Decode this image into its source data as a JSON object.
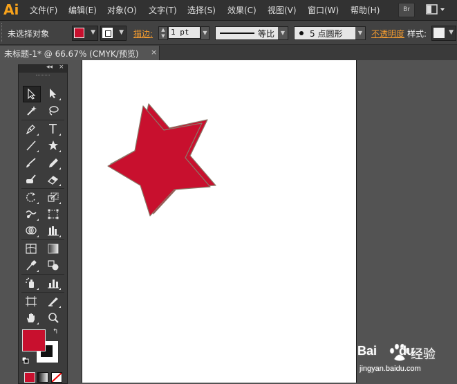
{
  "app": {
    "logo": "Ai",
    "bridge_button": "Br"
  },
  "menu": [
    "文件(F)",
    "编辑(E)",
    "对象(O)",
    "文字(T)",
    "选择(S)",
    "效果(C)",
    "视图(V)",
    "窗口(W)",
    "帮助(H)"
  ],
  "control_bar": {
    "selection_status": "未选择对象",
    "fill_color": "#c8102e",
    "stroke_label": "描边:",
    "stroke_weight": "1 pt",
    "profile_label": "等比",
    "brush_label": "5 点圆形",
    "opacity_label": "不透明度",
    "style_label": "样式:"
  },
  "document_tab": {
    "title": "未标题-1* @ 66.67% (CMYK/预览)",
    "close": "×"
  },
  "toolbox": {
    "collapse": "◂◂",
    "close": "×",
    "tools": [
      {
        "name": "selection-tool-icon",
        "active": true
      },
      {
        "name": "direct-selection-tool-icon"
      },
      {
        "name": "magic-wand-tool-icon"
      },
      {
        "name": "lasso-tool-icon"
      },
      {
        "name": "pen-tool-icon"
      },
      {
        "name": "type-tool-icon"
      },
      {
        "name": "line-segment-tool-icon"
      },
      {
        "name": "star-tool-icon"
      },
      {
        "name": "paintbrush-tool-icon"
      },
      {
        "name": "pencil-tool-icon"
      },
      {
        "name": "blob-brush-tool-icon"
      },
      {
        "name": "eraser-tool-icon"
      },
      {
        "name": "rotate-tool-icon"
      },
      {
        "name": "scale-tool-icon"
      },
      {
        "name": "warp-tool-icon"
      },
      {
        "name": "free-transform-tool-icon"
      },
      {
        "name": "shape-builder-tool-icon"
      },
      {
        "name": "perspective-grid-tool-icon"
      },
      {
        "name": "mesh-tool-icon"
      },
      {
        "name": "gradient-tool-icon"
      },
      {
        "name": "eyedropper-tool-icon"
      },
      {
        "name": "blend-tool-icon"
      },
      {
        "name": "symbol-sprayer-tool-icon"
      },
      {
        "name": "column-graph-tool-icon"
      },
      {
        "name": "artboard-tool-icon"
      },
      {
        "name": "slice-tool-icon"
      },
      {
        "name": "hand-tool-icon"
      },
      {
        "name": "zoom-tool-icon"
      }
    ],
    "fill_color": "#c8102e",
    "stroke_color": "#111111"
  },
  "canvas": {
    "artwork_fill": "#c8102e",
    "artwork_stroke": "#8a7a6a"
  },
  "watermark": {
    "brand": "Bai",
    "brand_suffix": "du",
    "cn": "经验",
    "url": "jingyan.baidu.com"
  }
}
